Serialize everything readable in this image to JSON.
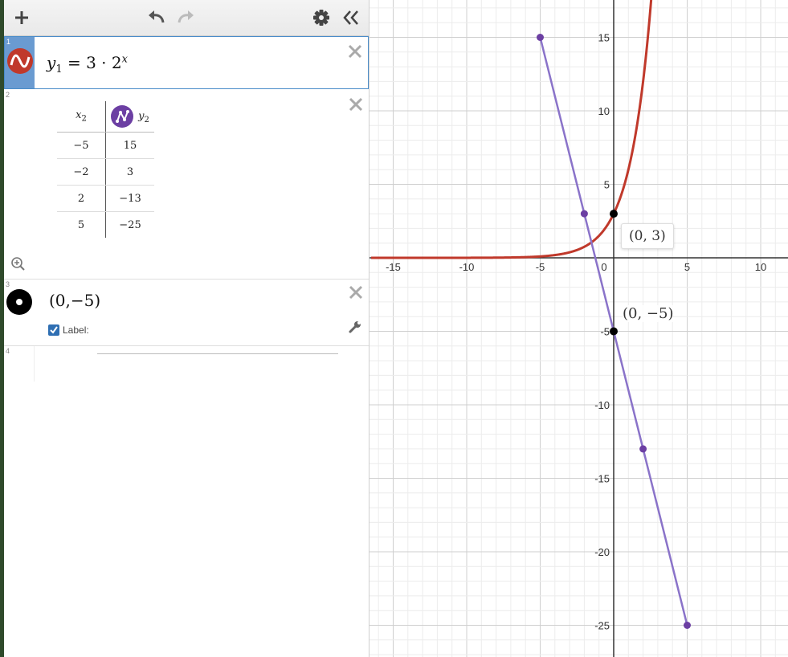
{
  "toolbar": {
    "add_icon": "plus-icon",
    "undo_icon": "undo-icon",
    "redo_icon": "redo-icon",
    "settings_icon": "gear-icon",
    "collapse_icon": "double-chevron-left-icon"
  },
  "expressions": [
    {
      "number": "1",
      "type": "function",
      "color": "#c0392b",
      "lhs": "y",
      "lhs_sub": "1",
      "rhs": "= 3 · 2",
      "exponent": "x"
    },
    {
      "number": "2",
      "type": "table",
      "color": "#6c3fa3",
      "headers": [
        {
          "var": "x",
          "sub": "2"
        },
        {
          "var": "y",
          "sub": "2"
        }
      ],
      "rows": [
        [
          "−5",
          "15"
        ],
        [
          "−2",
          "3"
        ],
        [
          "2",
          "−13"
        ],
        [
          "5",
          "−25"
        ]
      ]
    },
    {
      "number": "3",
      "type": "point",
      "color": "#000000",
      "text": "(0,−5)",
      "label_checkbox": "Label:",
      "label_checked": true
    },
    {
      "number": "4",
      "type": "empty"
    }
  ],
  "graph": {
    "x_ticks": [
      "-15",
      "-10",
      "-5",
      "0",
      "5",
      "10"
    ],
    "y_ticks": [
      "15",
      "10",
      "5",
      "-5",
      "-10",
      "-15",
      "-20",
      "-25"
    ],
    "tooltip": "(0, 3)",
    "point_label": "(0, −5)",
    "curve_color": "#c0392b",
    "table_color": "#8a73c9",
    "point_color": "#6c3fa3"
  },
  "chart_data": [
    {
      "type": "line",
      "name": "y1 = 3·2^x",
      "function": "3*2^x",
      "x_range": [
        -16.5,
        11.5
      ],
      "y_range": [
        -27,
        18
      ],
      "grid": true
    },
    {
      "type": "line",
      "name": "table x2, y2",
      "x": [
        -5,
        -2,
        2,
        5
      ],
      "y": [
        15,
        3,
        -13,
        -25
      ]
    },
    {
      "type": "scatter",
      "points": [
        {
          "x": 0,
          "y": -5
        },
        {
          "x": 0,
          "y": 3
        }
      ]
    }
  ]
}
